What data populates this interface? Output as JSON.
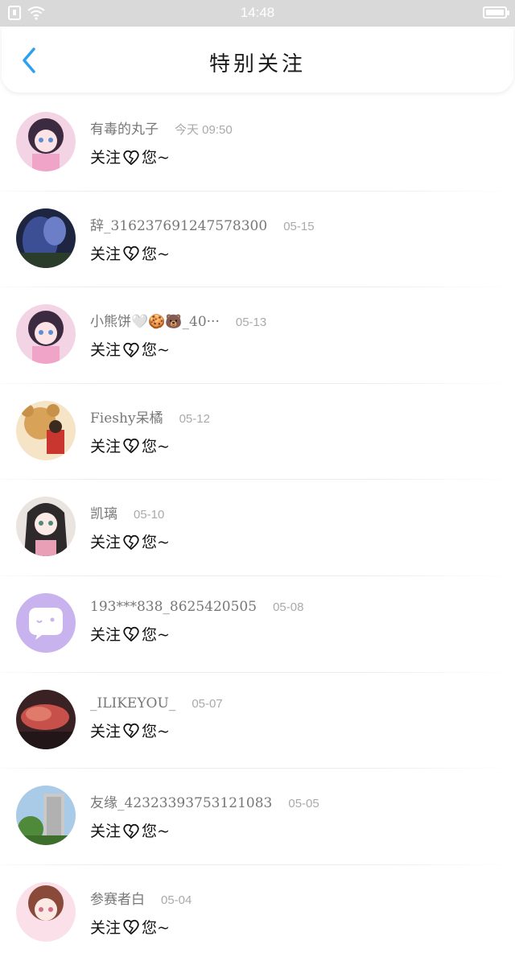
{
  "status_bar": {
    "time": "14:48"
  },
  "header": {
    "title": "特别关注"
  },
  "list": [
    {
      "name": "有毒的丸子",
      "time": "今天 09:50",
      "msg_before": "关注",
      "msg_after": "您~",
      "avatar": "anime-girl-pink-avatar"
    },
    {
      "name": "辞_316237691247578300",
      "time": "05-15",
      "msg_before": "关注",
      "msg_after": "您~",
      "avatar": "dark-blue-art-avatar"
    },
    {
      "name": "小熊饼🤍🍪🐻_40···",
      "time": "05-13",
      "msg_before": "关注",
      "msg_after": "您~",
      "avatar": "anime-girl-pink-avatar"
    },
    {
      "name": "Fieshy呆橘",
      "time": "05-12",
      "msg_before": "关注",
      "msg_after": "您~",
      "avatar": "teddy-bear-avatar"
    },
    {
      "name": "凯璃",
      "time": "05-10",
      "msg_before": "关注",
      "msg_after": "您~",
      "avatar": "anime-girl-dark-hair-avatar"
    },
    {
      "name": "193***838_8625420505",
      "time": "05-08",
      "msg_before": "关注",
      "msg_after": "您~",
      "avatar": "default-chat-avatar"
    },
    {
      "name": "_ILIKEYOU_",
      "time": "05-07",
      "msg_before": "关注",
      "msg_after": "您~",
      "avatar": "red-sky-avatar"
    },
    {
      "name": "友缘_423233937531210​83",
      "time": "05-05",
      "msg_before": "关注",
      "msg_after": "您~",
      "avatar": "building-avatar"
    },
    {
      "name": "参赛者白",
      "time": "05-04",
      "msg_before": "关注",
      "msg_after": "您~",
      "avatar": "anime-girl-pink-avatar"
    }
  ],
  "colors": {
    "accent": "#2ea0f0",
    "name_gray": "#777777",
    "time_gray": "#aaaaaa",
    "statusbar": "#d9d9d9"
  }
}
